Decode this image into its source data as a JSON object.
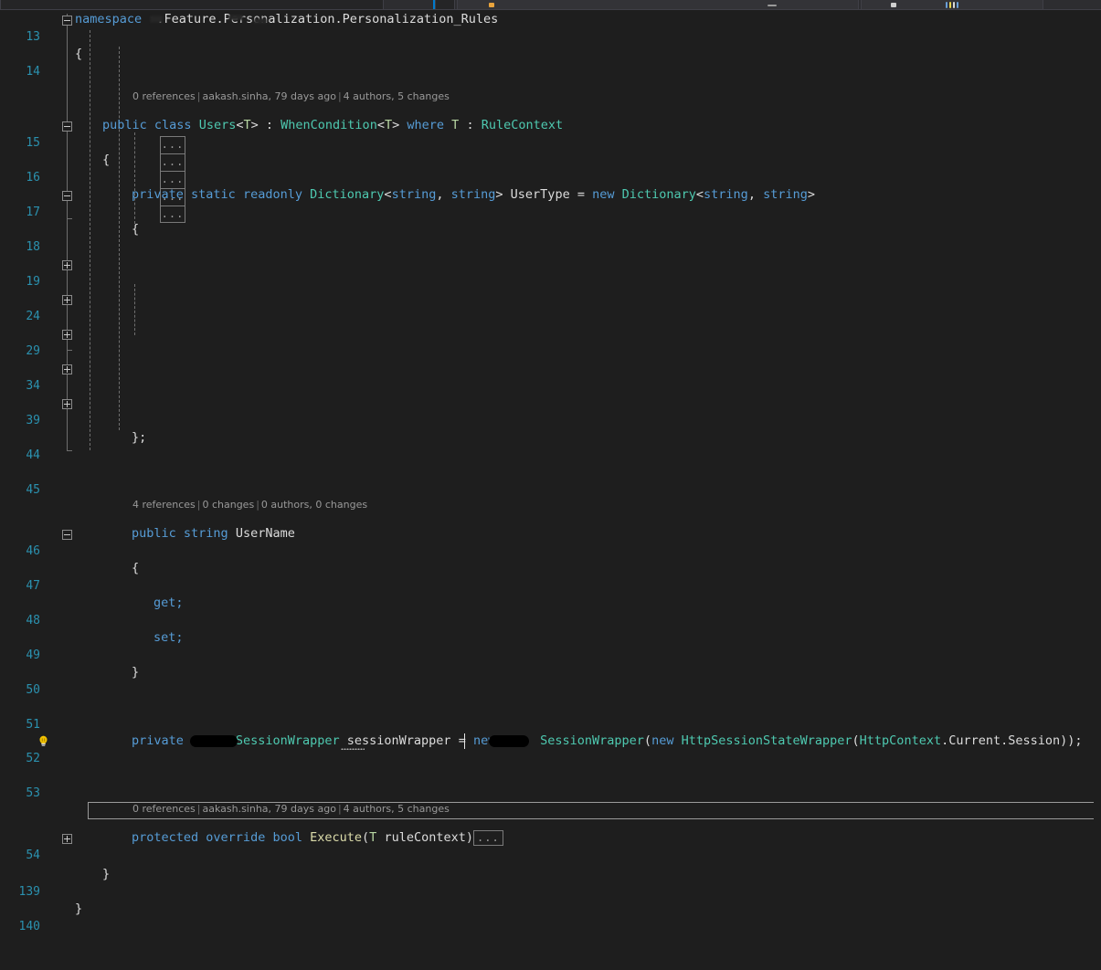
{
  "app": {
    "name": "visual-studio-code-editor",
    "theme": "dark",
    "language": "csharp"
  },
  "colors": {
    "background": "#1e1e1e",
    "line_number": "#2b91af",
    "keyword": "#569cd6",
    "type": "#4ec9b0",
    "method": "#dcdcaa",
    "identifier": "#dcdcdc",
    "generic_param": "#b8d7a3",
    "codelens": "#999999",
    "toolbar": "#2d2d30",
    "accent": "#007acc",
    "lightbulb": "#f2c200"
  },
  "toolbar": {
    "visible": true,
    "segments": [
      "toolbar-segment-left",
      "toolbar-segment-active",
      "toolbar-segment-main",
      "toolbar-segment-right"
    ]
  },
  "gutter": {
    "lightbulb_line": "52",
    "lightbulb_icon": "lightbulb-icon"
  },
  "codelens": {
    "class_users": {
      "references": "0 references",
      "author": "aakash.sinha, 79 days ago",
      "changes": "4 authors, 5 changes"
    },
    "property_username": {
      "references": "4 references",
      "author": "0 changes",
      "changes": "0 authors, 0 changes"
    },
    "method_execute": {
      "references": "0 references",
      "author": "aakash.sinha, 79 days ago",
      "changes": "4 authors, 5 changes"
    }
  },
  "collapsed": {
    "ellipsis": "...",
    "dictionary_entry_count": 5,
    "execute_body": "..."
  },
  "lines": {
    "13": "13",
    "14": "14",
    "15": "15",
    "16": "16",
    "17": "17",
    "18": "18",
    "19": "19",
    "24": "24",
    "29": "29",
    "34": "34",
    "39": "39",
    "44": "44",
    "45": "45",
    "46": "46",
    "47": "47",
    "48": "48",
    "49": "49",
    "50": "50",
    "51": "51",
    "52": "52",
    "53": "53",
    "54": "54",
    "139": "139",
    "140": "140"
  },
  "code": {
    "l13": {
      "kw_namespace": "namespace",
      "redacted": "  ",
      "suffix": ".Feature.Personalization.Personalization_Rules"
    },
    "l14": {
      "brace": "{"
    },
    "l15": {
      "kw_public": "public",
      "kw_class": "class",
      "type_users": "Users",
      "lt1": "<",
      "t1": "T",
      "gt1": ">",
      "colon1": " : ",
      "type_whencondition": "WhenCondition",
      "lt2": "<",
      "t2": "T",
      "gt2": ">",
      "kw_where": "where",
      "t3": "T",
      "colon2": " : ",
      "type_rulecontext": "RuleContext"
    },
    "l16": {
      "brace": "{"
    },
    "l17": {
      "kw_private": "private",
      "kw_static": "static",
      "kw_readonly": "readonly",
      "type_dictionary": "Dictionary",
      "lt1": "<",
      "kw_string1": "string",
      "comma1": ", ",
      "kw_string2": "string",
      "gt1": ">",
      "name_usertype": "UserType",
      "eq": " = ",
      "kw_new": "new",
      "type_dictionary2": "Dictionary",
      "lt2": "<",
      "kw_string3": "string",
      "comma2": ", ",
      "kw_string4": "string",
      "gt2": ">"
    },
    "l18": {
      "brace": "{"
    },
    "l44": {
      "close": "};"
    },
    "l46": {
      "kw_public": "public",
      "kw_string": "string",
      "name_username": "UserName"
    },
    "l47": {
      "brace": "{"
    },
    "l48": {
      "kw_get": "get;"
    },
    "l49": {
      "kw_set": "set;"
    },
    "l50": {
      "brace": "}"
    },
    "l52": {
      "kw_private": "private",
      "redacted1": "      ",
      "type_sessionwrapper": "SessionWrapper",
      "name_sessionwrapper": "sessionWrapper",
      "eq": " = ",
      "kw_new1": "new",
      "redacted2": "     ",
      "type_sessionwrapper2": "SessionWrapper",
      "paren_open1": "(",
      "kw_new2": "new",
      "type_httpsessionstatewrapper": "HttpSessionStateWrapper",
      "paren_open2": "(",
      "type_httpcontext": "HttpContext",
      "prop_current": ".Current",
      "prop_session": ".Session",
      "tail": "));"
    },
    "l54": {
      "kw_protected": "protected",
      "kw_override": "override",
      "kw_bool": "bool",
      "method_execute": "Execute",
      "paren_open": "(",
      "t": "T",
      "param_rulecontext": "ruleContext",
      "paren_close": ")",
      "body_collapsed": "..."
    },
    "l139": {
      "brace": "}"
    },
    "l140": {
      "brace": "}"
    }
  }
}
